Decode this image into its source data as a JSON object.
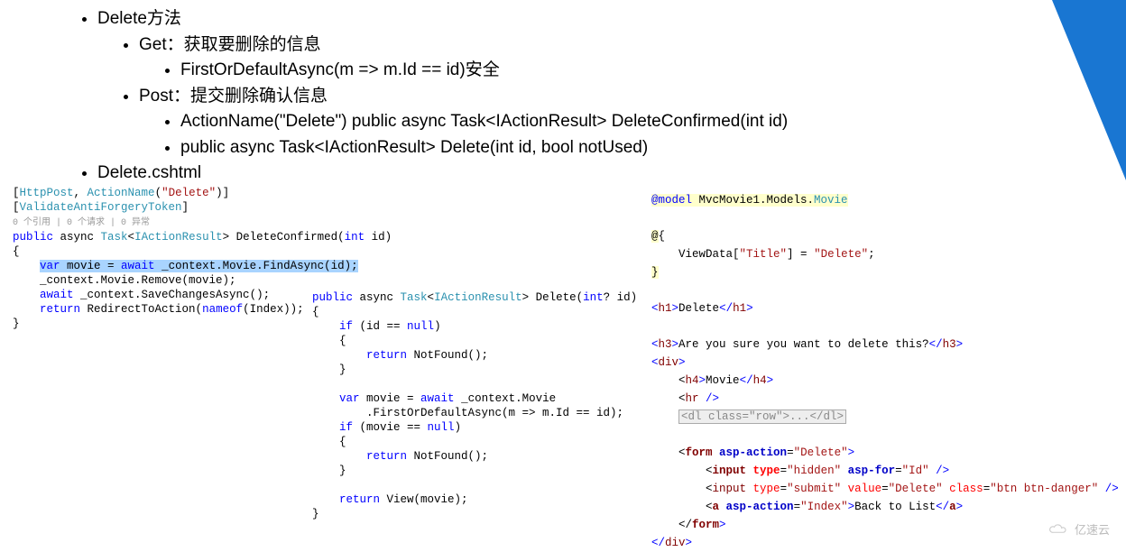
{
  "bullets": {
    "l1": "Delete方法",
    "l1a": "Get：获取要删除的信息",
    "l1a1": "FirstOrDefaultAsync(m => m.Id == id)安全",
    "l1b": "Post：提交删除确认信息",
    "l1b1": "ActionName(\"Delete\") public async Task<IActionResult> DeleteConfirmed(int id)",
    "l1b2": "public async Task<IActionResult> Delete(int id, bool notUsed)",
    "l2": "Delete.cshtml"
  },
  "code1": {
    "a1": "[",
    "a2": "HttpPost",
    "a3": ", ",
    "a4": "ActionName",
    "a5": "(",
    "a6": "\"Delete\"",
    "a7": ")]",
    "b1": "[",
    "b2": "ValidateAntiForgeryToken",
    "b3": "]",
    "ref": "0 个引用 | 0 个请求 | 0 异常",
    "c1": "public",
    "c2": " async ",
    "c3": "Task",
    "c4": "<",
    "c5": "IActionResult",
    "c6": "> DeleteConfirmed(",
    "c7": "int",
    "c8": " id)",
    "ob": "{",
    "hl1": "var",
    "hl2": " movie = ",
    "hl3": "await",
    "hl4": " _context.Movie.FindAsync(id);",
    "d1": "    _context.Movie.Remove(movie);",
    "e1": "    ",
    "e2": "await",
    "e3": " _context.SaveChangesAsync();",
    "f1": "    ",
    "f2": "return",
    "f3": " RedirectToAction(",
    "f4": "nameof",
    "f5": "(Index));",
    "cb": "}"
  },
  "code2": {
    "a1": "public",
    "a2": " async ",
    "a3": "Task",
    "a4": "<",
    "a5": "IActionResult",
    "a6": "> Delete(",
    "a7": "int",
    "a8": "? id)",
    "ob": "{",
    "b1": "    ",
    "b2": "if",
    "b3": " (id == ",
    "b4": "null",
    "b5": ")",
    "bo": "    {",
    "c1": "        ",
    "c2": "return",
    "c3": " NotFound();",
    "bc": "    }",
    "blank": "",
    "d1": "    ",
    "d2": "var",
    "d3": " movie = ",
    "d4": "await",
    "d5": " _context.Movie",
    "e1": "        .FirstOrDefaultAsync(m => m.Id == id);",
    "f1": "    ",
    "f2": "if",
    "f3": " (movie == ",
    "f4": "null",
    "f5": ")",
    "fo": "    {",
    "g1": "        ",
    "g2": "return",
    "g3": " NotFound();",
    "fc": "    }",
    "h1": "    ",
    "h2": "return",
    "h3": " View(movie);",
    "cb": "}"
  },
  "code3": {
    "a1": "@model",
    "a2": " MvcMovie1.Models.",
    "a3": "Movie",
    "b1": "@",
    "b2": "{",
    "c1": "    ViewData[",
    "c2": "\"Title\"",
    "c3": "] = ",
    "c4": "\"Delete\"",
    "c5": ";",
    "b3": "}",
    "h1o": "<",
    "h1": "h1",
    "h1c": ">",
    "h1t": "Delete",
    "h1e": "</",
    "h1f": ">",
    "h3o": "<",
    "h3": "h3",
    "h3c": ">",
    "h3t": "Are you sure you want to delete this?",
    "h3e": "</",
    "h3f": ">",
    "divO": "<",
    "div": "div",
    "divC": ">",
    "h4o": "    <",
    "h4": "h4",
    "h4c": ">",
    "h4t": "Movie",
    "h4e": "</",
    "h4f": ">",
    "hro": "    <",
    "hr": "hr",
    "hrc": " />",
    "dlBox": "<dl class=\"row\">...</dl>",
    "fo": "    <",
    "form": "form",
    "sp": " ",
    "aspA": "asp-action",
    "eq": "=",
    "vDel": "\"Delete\"",
    "gt": ">",
    "io": "        <",
    "input": "input",
    "typeA": "type",
    "vHid": "\"hidden\"",
    "aspF": "asp-for",
    "vId": "\"Id\"",
    "sc": " />",
    "vSub": "\"submit\"",
    "valueA": "value",
    "vDel2": "\"Delete\"",
    "classA": "class",
    "vBtn": "\"btn btn-danger\"",
    "ao": "        <",
    "a": "a",
    "vIdx": "\"Index\"",
    "aT": "Back to List",
    "ae": "</",
    "af": ">",
    "fe": "    </",
    "fc": ">",
    "de": "</",
    "dc": ">"
  },
  "logo": "亿速云"
}
